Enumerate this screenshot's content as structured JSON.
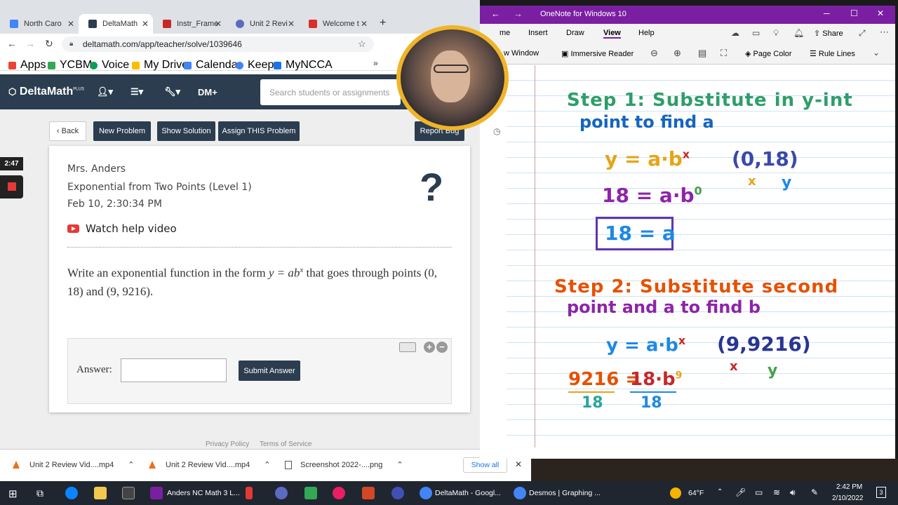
{
  "browser": {
    "tabs": [
      {
        "label": "North Caro",
        "color": "#4285f4"
      },
      {
        "label": "DeltaMath",
        "color": "#2b3d4f",
        "active": true
      },
      {
        "label": "Instr_Frame",
        "color": "#c62828"
      },
      {
        "label": "Unit 2 Revi",
        "color": "#5c6bc0"
      },
      {
        "label": "Welcome t",
        "color": "#d93025"
      }
    ],
    "new_tab": "+",
    "url": "deltamath.com/app/teacher/solve/1039646",
    "bookmarks": [
      {
        "label": "Apps",
        "color": "#ea4335"
      },
      {
        "label": "YCBM",
        "color": "#34a853"
      },
      {
        "label": "Voice",
        "color": "#0f9d58"
      },
      {
        "label": "My Drive",
        "color": "#fbbc04"
      },
      {
        "label": "Calendar",
        "color": "#4285f4"
      },
      {
        "label": "Keep",
        "color": "#4285f4"
      },
      {
        "label": "MyNCCA",
        "color": "#1a73e8"
      }
    ],
    "more": "»"
  },
  "deltamath": {
    "logo": "DeltaMath",
    "logo_sup": "PLUS",
    "dm_plus": "DM+",
    "search_placeholder": "Search students or assignments",
    "buttons": {
      "back": "Back",
      "new_problem": "New Problem",
      "show_solution": "Show Solution",
      "assign": "Assign THIS Problem",
      "report_bug": "Report Bug"
    },
    "timer": "2:47",
    "card": {
      "teacher": "Mrs. Anders",
      "topic": "Exponential from Two Points (Level 1)",
      "date": "Feb 10, 2:30:34 PM",
      "watch": "Watch help video",
      "question_pre": "Write an exponential function in the form ",
      "question_formula": "y = ab",
      "question_exp": "x",
      "question_mid": " that goes through points (0, 18) and (9, 9216).",
      "answer_label": "Answer:",
      "submit": "Submit Answer"
    },
    "footer": {
      "privacy": "Privacy Policy",
      "terms": "Terms of Service"
    }
  },
  "downloads": {
    "items": [
      "Unit 2 Review Vid....mp4",
      "Unit 2 Review Vid....mp4",
      "Screenshot 2022-....png"
    ],
    "show_all": "Show all"
  },
  "onenote": {
    "title": "OneNote for Windows 10",
    "menu": [
      "me",
      "Insert",
      "Draw",
      "View",
      "Help"
    ],
    "share": "Share",
    "ribbon": {
      "new_window": "w Window",
      "immersive": "Immersive Reader",
      "page_color": "Page Color",
      "rule_lines": "Rule Lines"
    },
    "ink": {
      "step1_a": "Step 1: Substitute in y-int",
      "step1_b": "point to find a",
      "eq1": "y = a·b",
      "eq1_exp": "x",
      "pt1": "(0,18)",
      "x1": "x",
      "y1": "y",
      "eq2": "18 = a·b",
      "eq2_exp": "0",
      "boxed": "18 = a",
      "step2_a": "Step 2: Substitute second",
      "step2_b": "point and a to find b",
      "eq3": "y = a·b",
      "eq3_exp": "x",
      "pt2": "(9,9216)",
      "x2": "x",
      "y2": "y",
      "eq4_left": "9216 =",
      "eq4_right": "18·b",
      "eq4_exp": "9",
      "den1": "18",
      "den2": "18"
    }
  },
  "taskbar": {
    "apps": [
      "Anders NC Math 3 L...",
      "DeltaMath - Googl...",
      "Desmos | Graphing ..."
    ],
    "weather": "64°F",
    "time": "2:42 PM",
    "date": "2/10/2022",
    "notif": "3"
  }
}
